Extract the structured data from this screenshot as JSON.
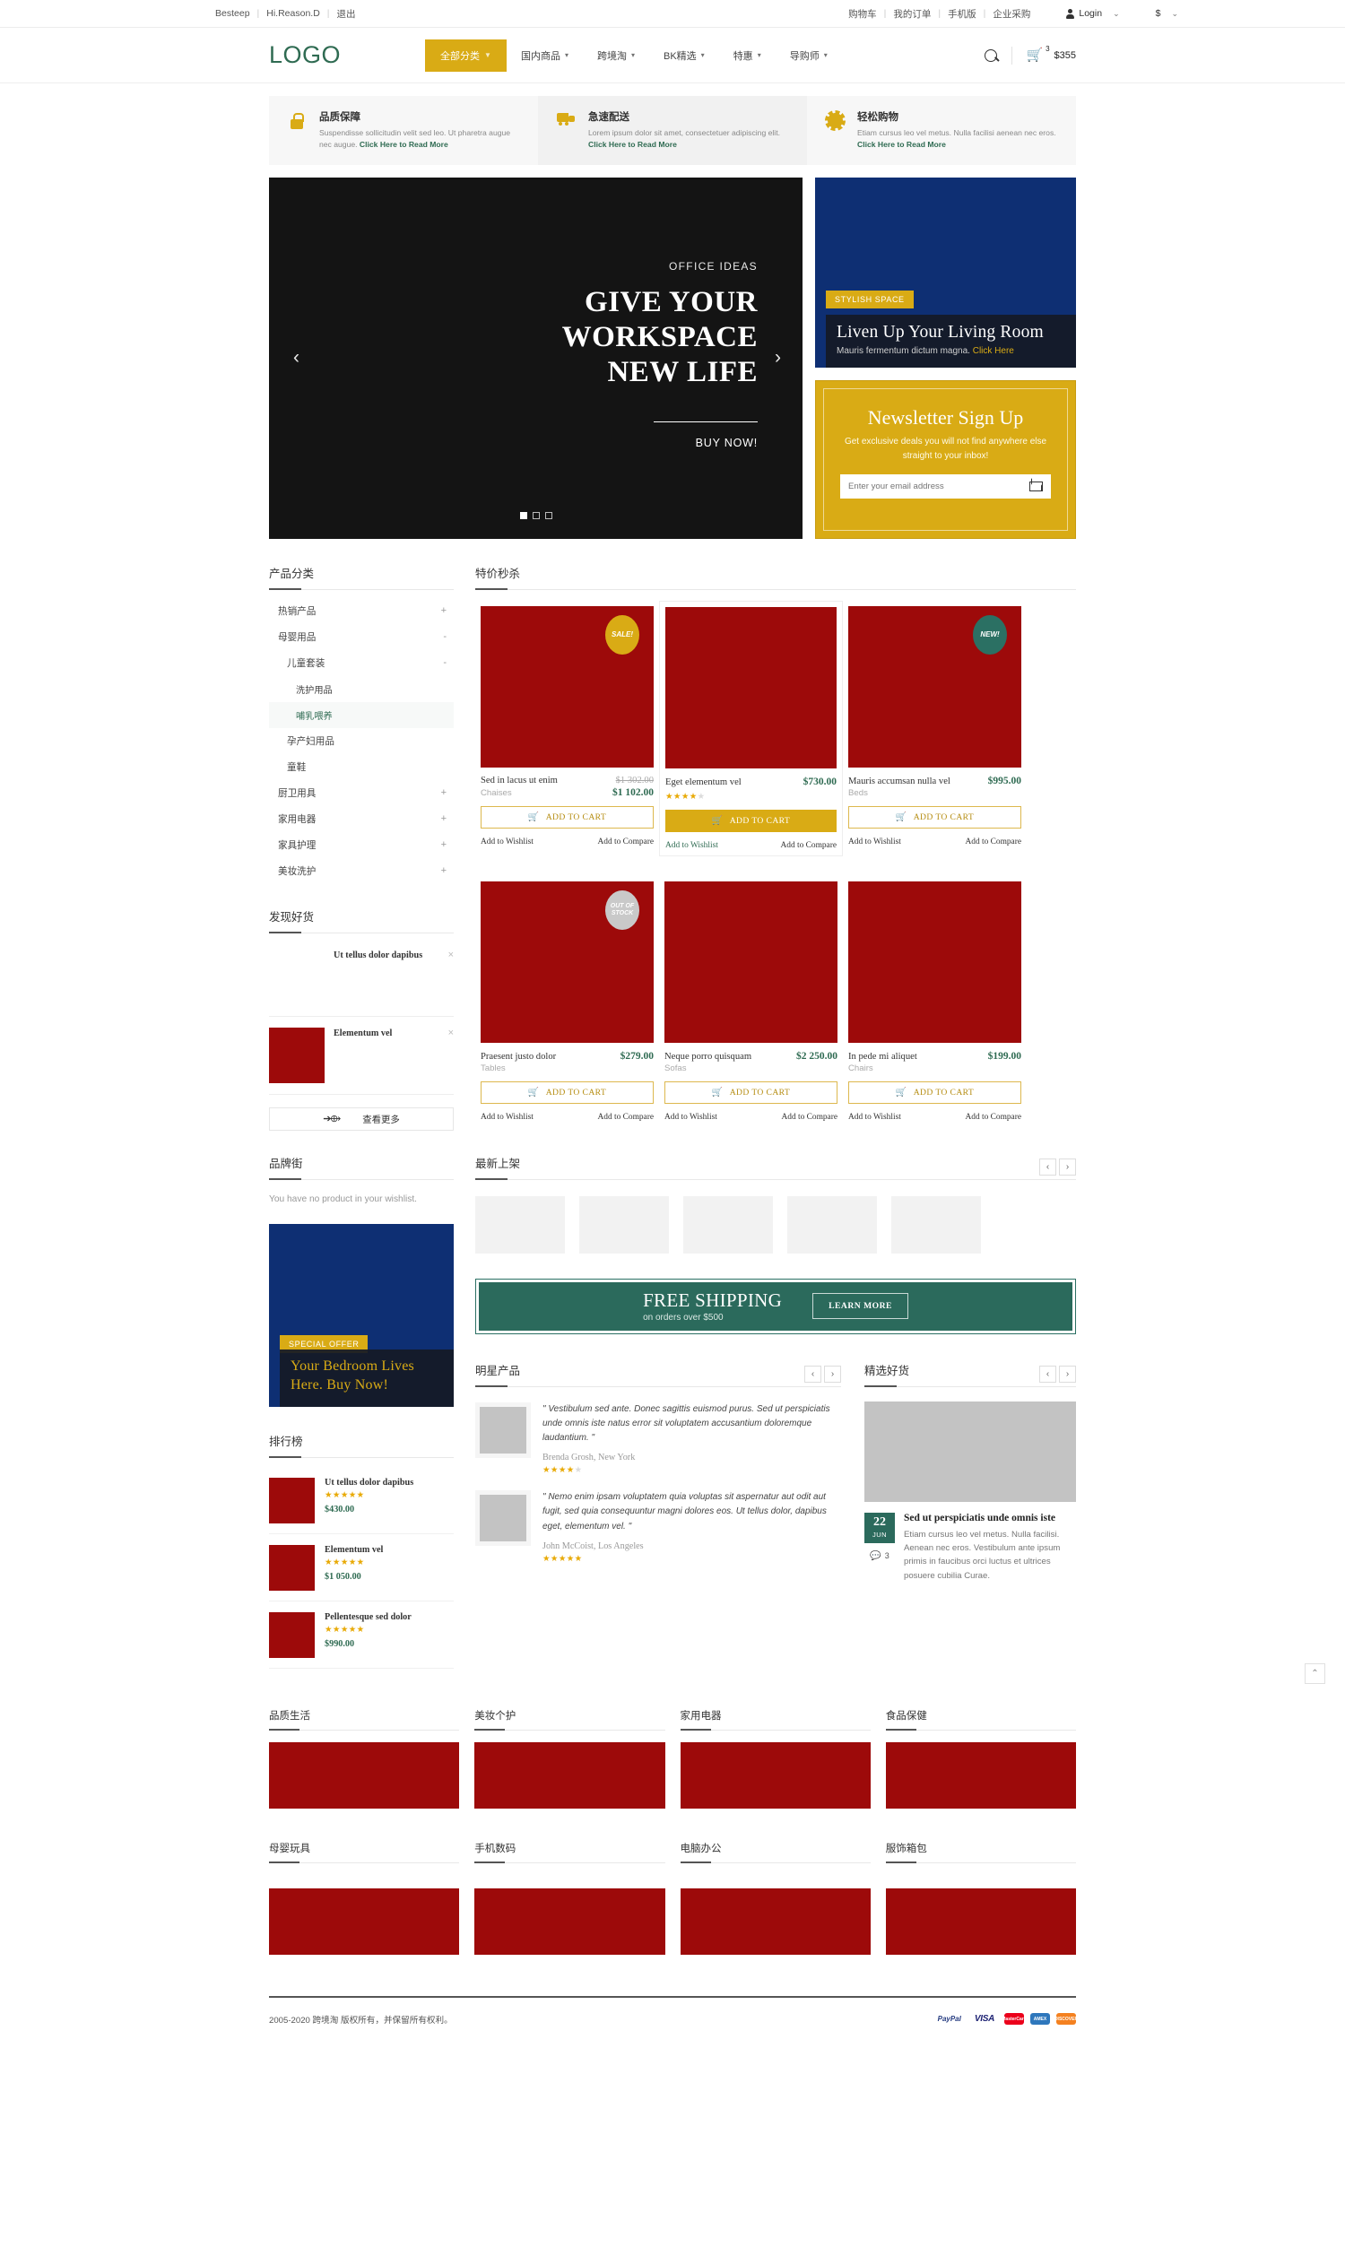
{
  "topbar": {
    "left": [
      "Besteep",
      "Hi.Reason.D",
      "退出"
    ],
    "links": [
      "购物车",
      "我的订单",
      "手机版",
      "企业采购"
    ],
    "login": "Login",
    "currency": "$"
  },
  "header": {
    "logo": "LOGO",
    "nav": [
      {
        "label": "全部分类",
        "active": true
      },
      {
        "label": "国内商品",
        "active": false
      },
      {
        "label": "跨境淘",
        "active": false
      },
      {
        "label": "BK精选",
        "active": false
      },
      {
        "label": "特惠",
        "active": false
      },
      {
        "label": "导购师",
        "active": false
      }
    ],
    "cart_count": "3",
    "cart_amount": "$355"
  },
  "services": [
    {
      "icon": "lock-icon",
      "title": "品质保障",
      "text": "Suspendisse sollicitudin velit sed leo. Ut pharetra augue nec augue. ",
      "cta": "Click Here to Read More"
    },
    {
      "icon": "truck-icon",
      "title": "急速配送",
      "text": "Lorem ipsum dolor sit amet, consectetuer adipiscing elit. ",
      "cta": "Click Here to Read More"
    },
    {
      "icon": "gear-icon",
      "title": "轻松购物",
      "text": "Etiam cursus leo vel metus. Nulla facilisi aenean nec eros. ",
      "cta": "Click Here to Read More"
    }
  ],
  "hero": {
    "kicker": "OFFICE IDEAS",
    "line1": "GIVE YOUR",
    "line2": "WORKSPACE",
    "line3": "NEW LIFE",
    "cta": "BUY NOW!",
    "prev": "‹",
    "next": "›"
  },
  "promo": {
    "tag": "STYLISH SPACE",
    "title": "Liven Up Your Living Room",
    "text": "Mauris fermentum dictum magna. ",
    "link": "Click Here"
  },
  "newsletter": {
    "title": "Newsletter Sign Up",
    "text": "Get exclusive deals you will not find anywhere else straight to your inbox!",
    "placeholder": "Enter your email address"
  },
  "sidebar": {
    "categories_title": "产品分类",
    "categories": [
      {
        "label": "热销产品",
        "level": 1,
        "toggle": "+",
        "selected": false
      },
      {
        "label": "母婴用品",
        "level": 1,
        "toggle": "-",
        "selected": false
      },
      {
        "label": "儿童套装",
        "level": 2,
        "toggle": "-",
        "selected": false
      },
      {
        "label": "洗护用品",
        "level": 3,
        "toggle": "",
        "selected": false
      },
      {
        "label": "哺乳喂养",
        "level": 3,
        "toggle": "",
        "selected": true
      },
      {
        "label": "孕产妇用品",
        "level": 2,
        "toggle": "",
        "selected": false
      },
      {
        "label": "童鞋",
        "level": 2,
        "toggle": "",
        "selected": false
      },
      {
        "label": "厨卫用具",
        "level": 1,
        "toggle": "+",
        "selected": false
      },
      {
        "label": "家用电器",
        "level": 1,
        "toggle": "+",
        "selected": false
      },
      {
        "label": "家具护理",
        "level": 1,
        "toggle": "+",
        "selected": false
      },
      {
        "label": "美妆洗护",
        "level": 1,
        "toggle": "+",
        "selected": false
      }
    ],
    "recent_title": "发现好货",
    "recent": [
      {
        "name": "Ut tellus dolor dapibus",
        "has_image": false,
        "close": "×"
      },
      {
        "name": "Elementum vel",
        "has_image": true,
        "close": "×"
      }
    ],
    "see_more": "查看更多",
    "brand_title": "品牌街",
    "wishlist_note": "You have no product in your wishlist.",
    "banner": {
      "tag": "SPECIAL OFFER",
      "title": "Your Bedroom Lives Here.",
      "cta": "Buy Now!"
    },
    "rank_title": "排行榜",
    "rank": [
      {
        "name": "Ut tellus dolor dapibus",
        "stars": 5,
        "price": "$430.00"
      },
      {
        "name": "Elementum vel",
        "stars": 5,
        "price": "$1 050.00"
      },
      {
        "name": "Pellentesque sed dolor",
        "stars": 5,
        "price": "$990.00"
      }
    ]
  },
  "flash": {
    "title": "特价秒杀",
    "add_to_cart": "ADD TO CART",
    "wishlist": "Add to Wishlist",
    "compare": "Add to Compare",
    "products": [
      {
        "name": "Sed in lacus ut enim",
        "cat": "Chaises",
        "price": "$1 102.00",
        "old_price": "$1 302.00",
        "badge": "SALE!",
        "badge_type": "sale",
        "stars": 0,
        "highlight": false,
        "filled": false
      },
      {
        "name": "Eget elementum vel",
        "cat": "",
        "price": "$730.00",
        "old_price": "",
        "badge": "",
        "badge_type": "",
        "stars": 4,
        "highlight": true,
        "filled": true
      },
      {
        "name": "Mauris accumsan nulla vel",
        "cat": "Beds",
        "price": "$995.00",
        "old_price": "",
        "badge": "NEW!",
        "badge_type": "new",
        "stars": 0,
        "highlight": false,
        "filled": false
      },
      {
        "name": "Praesent justo dolor",
        "cat": "Tables",
        "price": "$279.00",
        "old_price": "",
        "badge": "OUT OF STOCK",
        "badge_type": "oos",
        "stars": 0,
        "highlight": false,
        "filled": false
      },
      {
        "name": "Neque porro quisquam",
        "cat": "Sofas",
        "price": "$2 250.00",
        "old_price": "",
        "badge": "",
        "badge_type": "",
        "stars": 0,
        "highlight": false,
        "filled": false
      },
      {
        "name": "In pede mi aliquet",
        "cat": "Chairs",
        "price": "$199.00",
        "old_price": "",
        "badge": "",
        "badge_type": "",
        "stars": 0,
        "highlight": false,
        "filled": false
      }
    ]
  },
  "latest": {
    "title": "最新上架",
    "prev": "‹",
    "next": "›"
  },
  "shipping": {
    "title": "FREE SHIPPING",
    "subtitle": "on orders over $500",
    "button": "LEARN MORE"
  },
  "testimonials": {
    "title": "明星产品",
    "prev": "‹",
    "next": "›",
    "items": [
      {
        "quote": "\" Vestibulum sed ante. Donec sagittis euismod purus. Sed ut perspiciatis unde omnis iste natus error sit voluptatem accusantium doloremque laudantium. \"",
        "author": "Brenda Grosh,",
        "place": " New York",
        "stars": 4
      },
      {
        "quote": "\" Nemo enim ipsam voluptatem quia voluptas sit aspernatur aut odit aut fugit, sed quia consequuntur magni dolores eos. Ut tellus dolor, dapibus eget, elementum vel. \"",
        "author": "John McCoist,",
        "place": " Los Angeles",
        "stars": 5
      }
    ]
  },
  "blog": {
    "title": "精选好货",
    "prev": "‹",
    "next": "›",
    "day": "22",
    "month": "JUN",
    "comments": "3",
    "post_title": "Sed ut perspiciatis unde omnis iste",
    "excerpt": "Etiam cursus leo vel metus. Nulla facilisi. Aenean nec eros. Vestibulum ante ipsum primis in faucibus orci luctus et ultrices posuere cubilia Curae."
  },
  "bottom_categories_row1": [
    "品质生活",
    "美妆个护",
    "家用电器",
    "食品保健"
  ],
  "bottom_categories_row2": [
    "母婴玩具",
    "手机数码",
    "电脑办公",
    "服饰箱包"
  ],
  "footer": {
    "copyright": "2005-2020 跨境淘 版权所有，并保留所有权利。",
    "payments": [
      "PayPal",
      "VISA",
      "MasterCard",
      "AMEX",
      "DISCOVER"
    ]
  },
  "scroll_top": "⌃"
}
